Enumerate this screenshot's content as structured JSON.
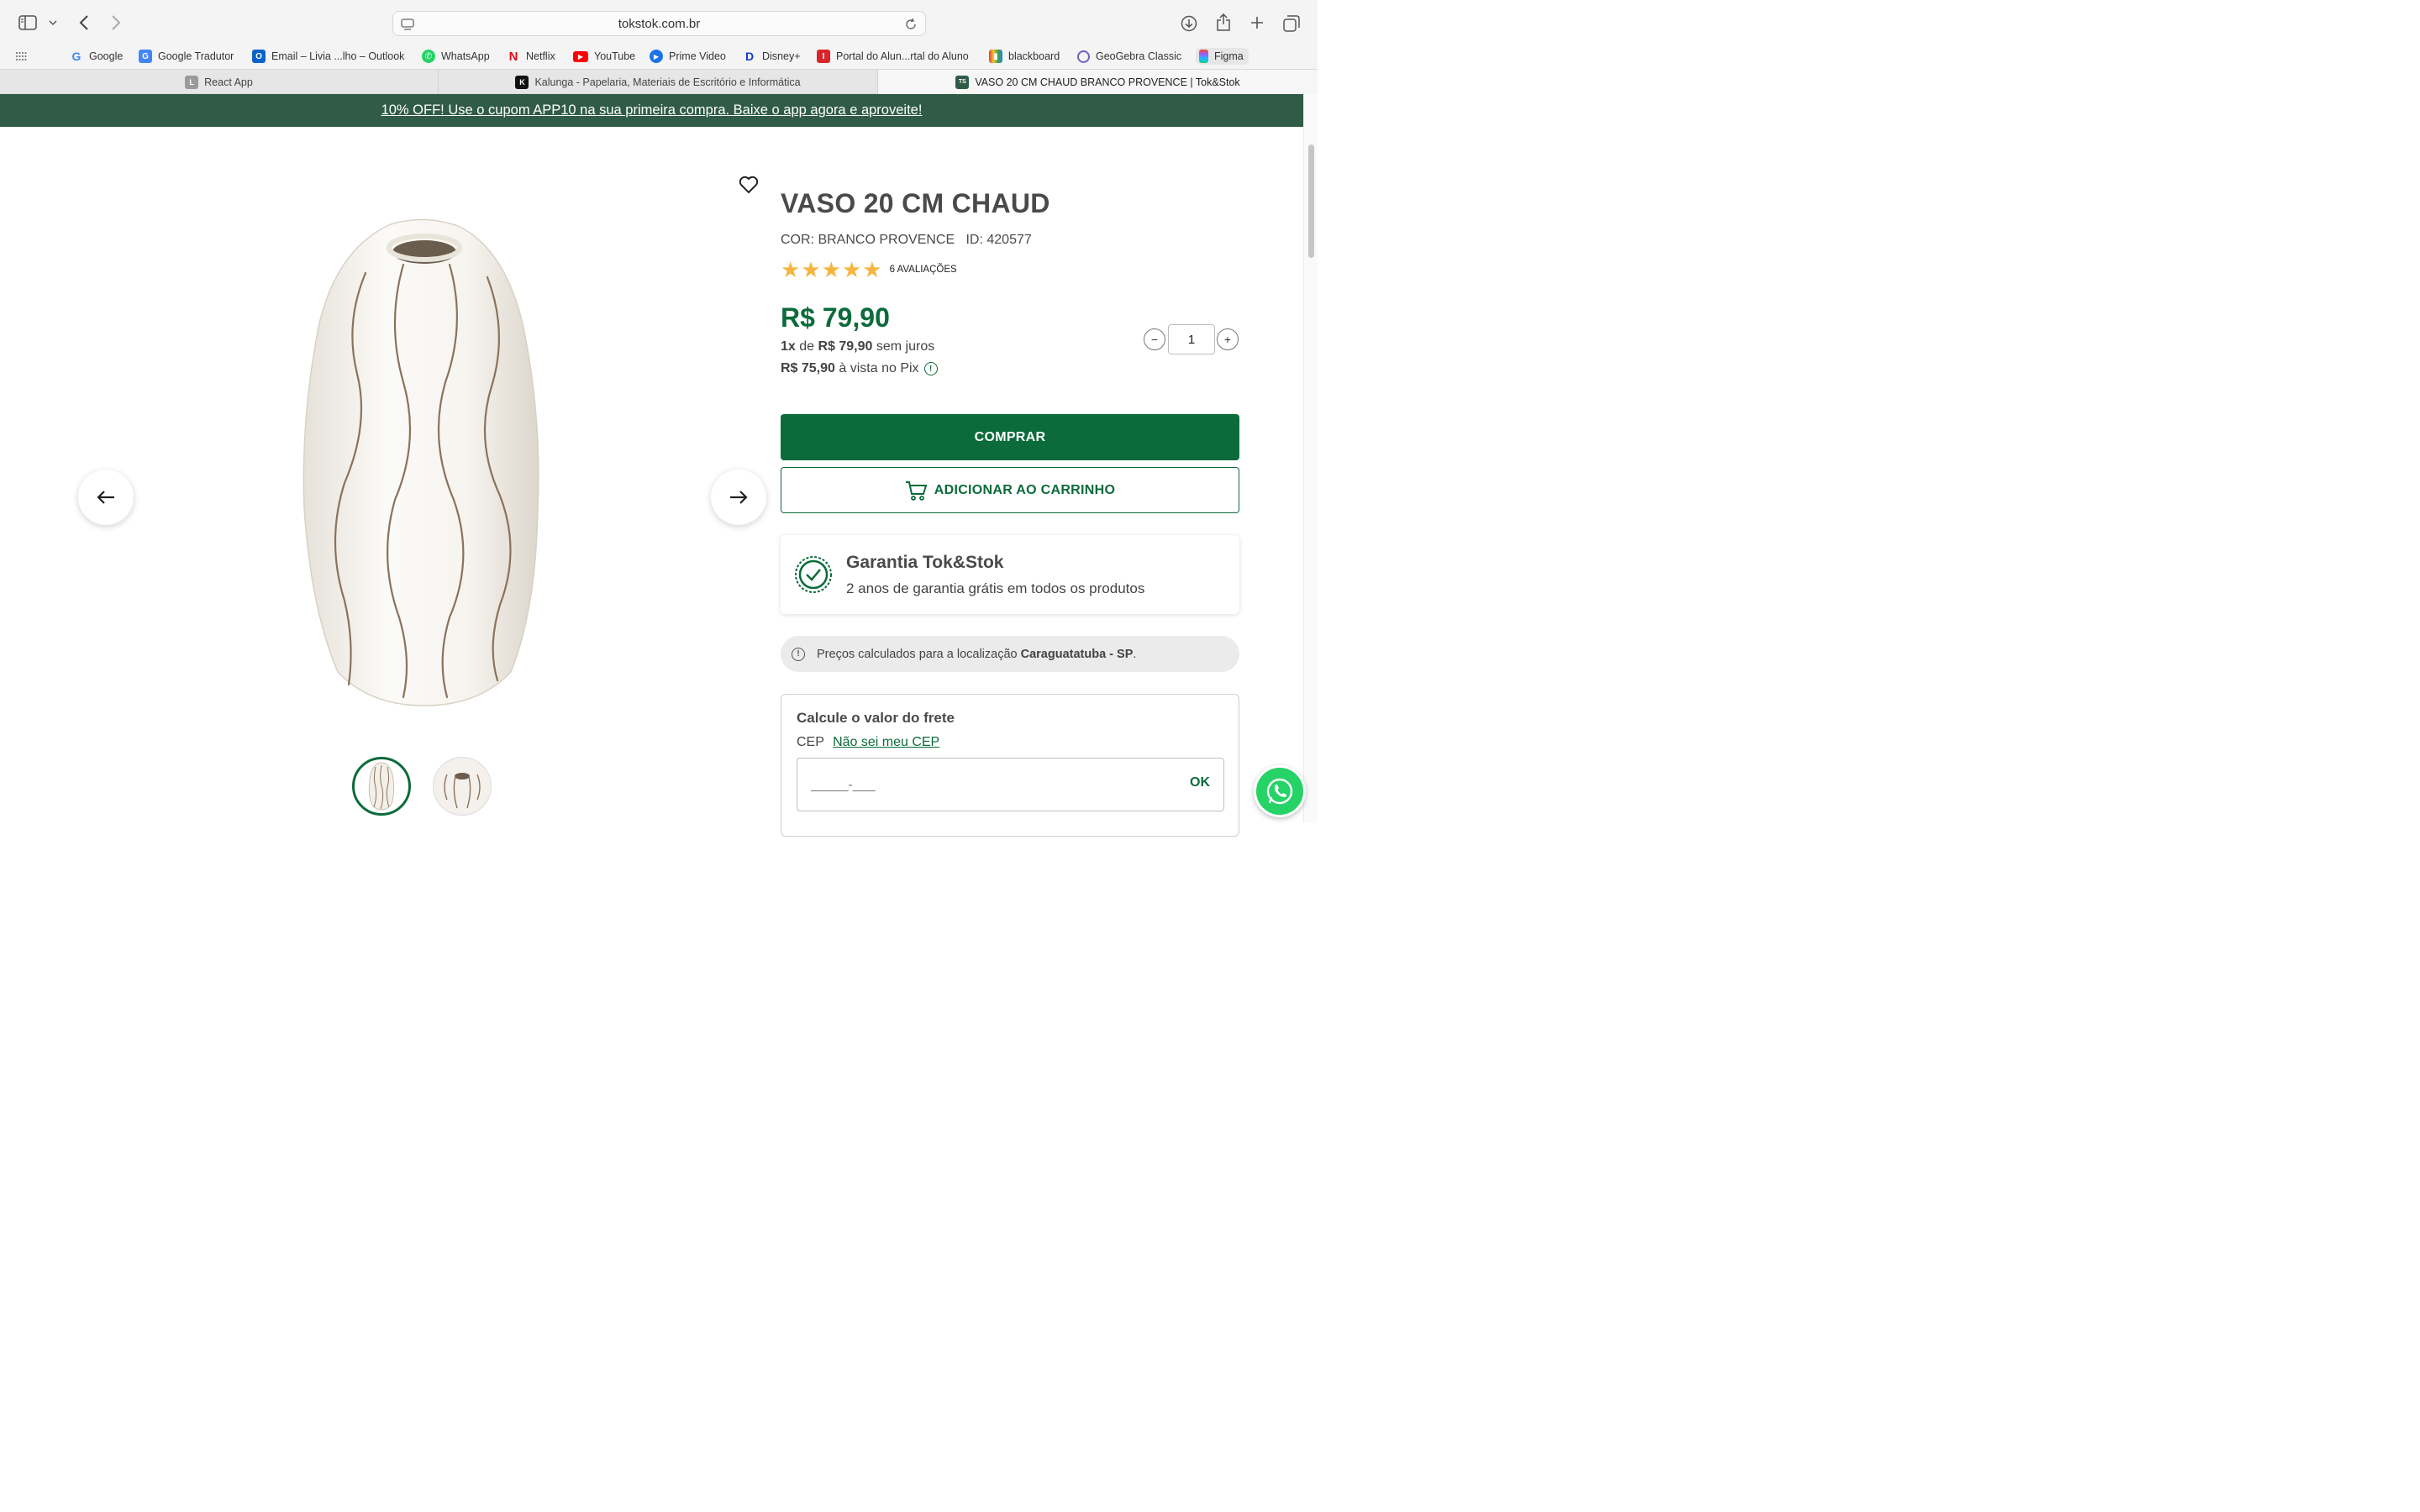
{
  "browser": {
    "url": "tokstok.com.br",
    "bookmarks": [
      {
        "label": "Google",
        "icon": "google-icon",
        "color": "#4285f4"
      },
      {
        "label": "Google Tradutor",
        "icon": "google-translate-icon",
        "color": "#4285f4"
      },
      {
        "label": "Email – Livia ...lho – Outlook",
        "icon": "outlook-icon",
        "color": "#0a64c8"
      },
      {
        "label": "WhatsApp",
        "icon": "whatsapp-icon",
        "color": "#25d366"
      },
      {
        "label": "Netflix",
        "icon": "netflix-icon",
        "color": "#e50914"
      },
      {
        "label": "YouTube",
        "icon": "youtube-icon",
        "color": "#ff0000"
      },
      {
        "label": "Prime Video",
        "icon": "prime-video-icon",
        "color": "#1a73e8"
      },
      {
        "label": "Disney+",
        "icon": "disney-icon",
        "color": "#113ccf"
      },
      {
        "label": "Portal do Alun...rtal do Aluno",
        "icon": "portal-icon",
        "color": "#d9252a"
      },
      {
        "label": "blackboard",
        "icon": "blackboard-icon",
        "color": "#333333"
      },
      {
        "label": "GeoGebra Classic",
        "icon": "geogebra-icon",
        "color": "#6b63c9"
      },
      {
        "label": "Figma",
        "icon": "figma-icon",
        "color": "#f24e1e"
      }
    ],
    "tabs": [
      {
        "label": "React App",
        "favicon": "L"
      },
      {
        "label": "Kalunga - Papelaria, Materiais de Escritório e Informática",
        "favicon": "K"
      },
      {
        "label": "VASO 20 CM CHAUD BRANCO PROVENCE | Tok&Stok",
        "favicon": "TS"
      }
    ]
  },
  "promo": {
    "text": "10% OFF! Use o cupom APP10 na sua primeira compra. Baixe o app agora e aproveite!"
  },
  "product": {
    "title": "VASO 20 CM CHAUD",
    "color_label": "COR: BRANCO PROVENCE",
    "id_label": "ID: 420577",
    "rating": 5,
    "reviews": "6 AVALIAÇÕES",
    "price": "R$ 79,90",
    "install_count": "1x",
    "install_de": " de ",
    "install_value": "R$ 79,90",
    "install_suffix": " sem juros",
    "pix_value": "R$ 75,90",
    "pix_suffix": " à vista no Pix",
    "quantity": "1",
    "qty_minus": "−",
    "qty_plus": "+"
  },
  "actions": {
    "buy": "COMPRAR",
    "add_to_cart": "ADICIONAR AO CARRINHO"
  },
  "warranty": {
    "title": "Garantia Tok&Stok",
    "desc": "2 anos de garantia grátis em todos os produtos"
  },
  "location": {
    "prefix": "Preços calculados para a localização ",
    "city": "Caraguatatuba - SP",
    "suffix": "."
  },
  "shipping": {
    "title": "Calcule o valor do frete",
    "cep_label": "CEP",
    "cep_link": "Não sei meu CEP",
    "placeholder": "_____-___",
    "ok": "OK"
  },
  "colors": {
    "brand_green": "#0b6b3a",
    "promo_bar": "#2f5b47",
    "star": "#f4b63f"
  }
}
